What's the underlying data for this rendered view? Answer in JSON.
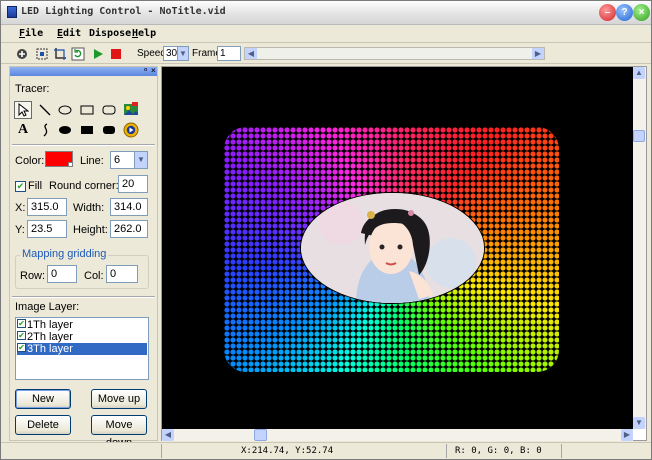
{
  "window": {
    "title": "LED Lighting Control - NoTitle.vid"
  },
  "menu": {
    "items": [
      {
        "label": "File",
        "accel": "F"
      },
      {
        "label": "Edit",
        "accel": "E"
      },
      {
        "label": "Dispose",
        "accel": ""
      },
      {
        "label": "Help",
        "accel": "H"
      }
    ]
  },
  "toolbar": {
    "speed_label": "Speed:",
    "speed_value": "30",
    "frame_label": "Frame:",
    "frame_value": "1"
  },
  "panel": {
    "tracer_label": "Tracer:",
    "color_label": "Color:",
    "color_value": "#ff0000",
    "line_label": "Line:",
    "line_value": "6",
    "fill_label": "Fill",
    "fill_checked": true,
    "round_corner_label": "Round corner:",
    "round_corner_value": "20",
    "x_label": "X:",
    "x_value": "315.0",
    "width_label": "Width:",
    "width_value": "314.0",
    "y_label": "Y:",
    "y_value": "23.5",
    "height_label": "Height:",
    "height_value": "262.0",
    "mapping_title": "Mapping gridding",
    "row_label": "Row:",
    "row_value": "0",
    "col_label": "Col:",
    "col_value": "0",
    "image_layer_label": "Image Layer:",
    "layers": [
      {
        "label": "1Th layer",
        "checked": true,
        "selected": false
      },
      {
        "label": "2Th layer",
        "checked": true,
        "selected": false
      },
      {
        "label": "3Th layer",
        "checked": true,
        "selected": true
      }
    ],
    "buttons": {
      "new": "New",
      "move_up": "Move up",
      "delete": "Delete",
      "move_down": "Move down"
    }
  },
  "status": {
    "coords": "X:214.74, Y:52.74",
    "rgb": "R:  0, G:  0, B:  0"
  }
}
